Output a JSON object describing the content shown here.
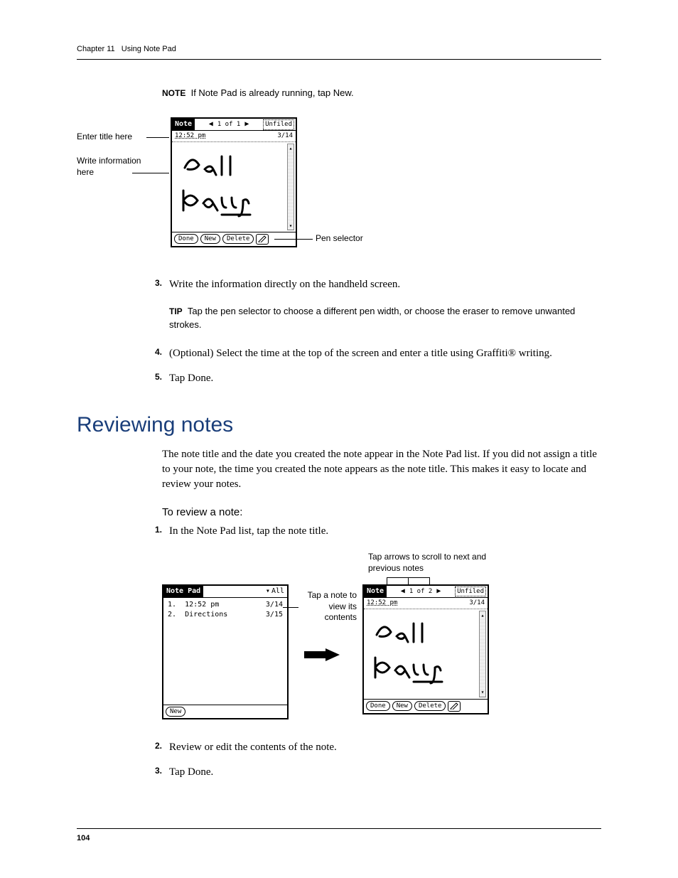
{
  "header": {
    "chapter": "Chapter 11",
    "title": "Using Note Pad"
  },
  "note": {
    "label": "NOTE",
    "text": "If Note Pad is already running, tap New."
  },
  "fig1": {
    "callouts": {
      "enter_title": "Enter title here",
      "write_info": "Write information here",
      "pen_selector": "Pen selector"
    },
    "palm": {
      "title": "Note",
      "nav_count": "1 of 1",
      "category": "Unfiled",
      "time": "12:52 pm",
      "date": "3/14",
      "handwriting": "Call Harry",
      "buttons": {
        "done": "Done",
        "new": "New",
        "delete": "Delete"
      }
    }
  },
  "steps_a": {
    "s3": {
      "num": "3.",
      "text": "Write the information directly on the handheld screen."
    },
    "tip": {
      "label": "TIP",
      "text": "Tap the pen selector to choose a different pen width, or choose the eraser to remove unwanted strokes."
    },
    "s4": {
      "num": "4.",
      "text": "(Optional) Select the time at the top of the screen and enter a title using Graffiti® writing."
    },
    "s5": {
      "num": "5.",
      "text": "Tap Done."
    }
  },
  "section": {
    "heading": "Reviewing notes",
    "intro": "The note title and the date you created the note appear in the Note Pad list. If you did not assign a title to your note, the time you created the note appears as the note title. This makes it easy to locate and review your notes.",
    "subhead": "To review a note:"
  },
  "steps_b": {
    "s1": {
      "num": "1.",
      "text": "In the Note Pad list, tap the note title."
    },
    "s2": {
      "num": "2.",
      "text": "Review or edit the contents of the note."
    },
    "s3": {
      "num": "3.",
      "text": "Tap Done."
    }
  },
  "fig2": {
    "callouts": {
      "scroll": "Tap arrows to scroll to next and previous notes",
      "tap_note": "Tap a note to view its contents"
    },
    "list_palm": {
      "title": "Note Pad",
      "category": "All",
      "rows": [
        {
          "idx": "1.",
          "label": "12:52 pm",
          "date": "3/14"
        },
        {
          "idx": "2.",
          "label": "Directions",
          "date": "3/15"
        }
      ],
      "new_btn": "New"
    },
    "detail_palm": {
      "title": "Note",
      "nav_count": "1 of 2",
      "category": "Unfiled",
      "time": "12:52 pm",
      "date": "3/14",
      "handwriting": "Call Harry",
      "buttons": {
        "done": "Done",
        "new": "New",
        "delete": "Delete"
      }
    }
  },
  "page_number": "104"
}
